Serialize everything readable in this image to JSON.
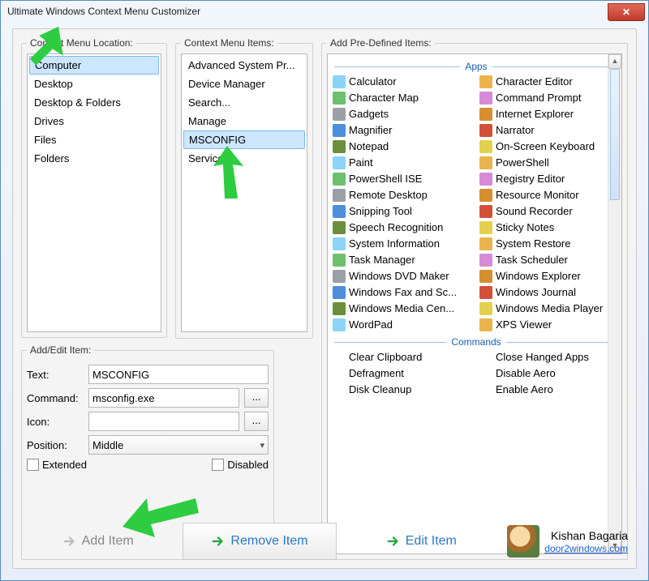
{
  "window": {
    "title": "Ultimate Windows Context Menu Customizer"
  },
  "sections": {
    "location_label": "Context Menu Location:",
    "items_label": "Context Menu Items:",
    "predef_label": "Add Pre-Defined Items:",
    "addedit_label": "Add/Edit Item:"
  },
  "locations": [
    {
      "label": "Computer",
      "selected": true
    },
    {
      "label": "Desktop",
      "selected": false
    },
    {
      "label": "Desktop & Folders",
      "selected": false
    },
    {
      "label": "Drives",
      "selected": false
    },
    {
      "label": "Files",
      "selected": false
    },
    {
      "label": "Folders",
      "selected": false
    }
  ],
  "menu_items": [
    {
      "label": "Advanced System Pr...",
      "selected": false
    },
    {
      "label": "Device Manager",
      "selected": false
    },
    {
      "label": "Search...",
      "selected": false
    },
    {
      "label": "Manage",
      "selected": false
    },
    {
      "label": "MSCONFIG",
      "selected": true
    },
    {
      "label": "Services",
      "selected": false
    }
  ],
  "form": {
    "text_label": "Text:",
    "text_value": "MSCONFIG",
    "command_label": "Command:",
    "command_value": "msconfig.exe",
    "icon_label": "Icon:",
    "icon_value": "",
    "position_label": "Position:",
    "position_value": "Middle",
    "browse_label": "...",
    "extended_label": "Extended",
    "extended_checked": false,
    "disabled_label": "Disabled",
    "disabled_checked": false
  },
  "buttons": {
    "add": "Add Item",
    "remove": "Remove Item",
    "edit": "Edit Item"
  },
  "predef": {
    "apps_header": "Apps",
    "commands_header": "Commands",
    "apps": [
      "Calculator",
      "Character Editor",
      "Character Map",
      "Command Prompt",
      "Gadgets",
      "Internet Explorer",
      "Magnifier",
      "Narrator",
      "Notepad",
      "On-Screen Keyboard",
      "Paint",
      "PowerShell",
      "PowerShell ISE",
      "Registry Editor",
      "Remote Desktop",
      "Resource Monitor",
      "Snipping Tool",
      "Sound Recorder",
      "Speech Recognition",
      "Sticky Notes",
      "System Information",
      "System Restore",
      "Task Manager",
      "Task Scheduler",
      "Windows DVD Maker",
      "Windows Explorer",
      "Windows Fax and Sc...",
      "Windows Journal",
      "Windows Media Cen...",
      "Windows Media Player",
      "WordPad",
      "XPS Viewer"
    ],
    "commands": [
      "Clear Clipboard",
      "Close Hanged Apps",
      "Defragment",
      "Disable Aero",
      "Disk Cleanup",
      "Enable Aero"
    ]
  },
  "credits": {
    "name": "Kishan Bagaria",
    "site": "door2windows.com"
  }
}
